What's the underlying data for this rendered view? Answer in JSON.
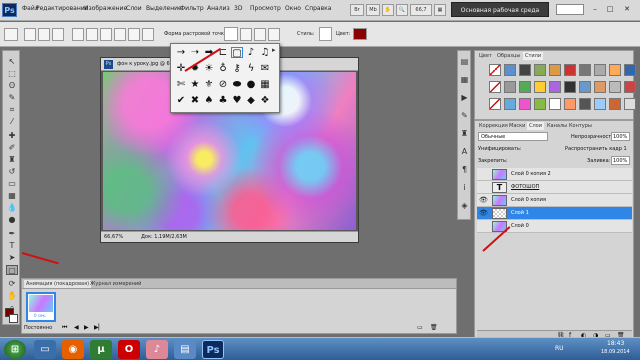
{
  "app": {
    "logo": "Ps"
  },
  "menu": [
    "Файл",
    "Редактирование",
    "Изображение",
    "Слои",
    "Выделение",
    "Фильтр",
    "Анализ",
    "3D",
    "Просмотр",
    "Окно",
    "Справка"
  ],
  "menubar": {
    "zoom": "66,7",
    "workspace_button": "Основная рабочая среда"
  },
  "options_bar": {
    "shape_label": "Форма растровой точки:",
    "style_label": "Стиль:",
    "color_label": "Цвет:",
    "color_value": "#8b0000"
  },
  "document": {
    "title": "фон к уроку.jpg @ 66,7",
    "zoom": "66,67%",
    "doc_info": "Док: 1,19M/2,63M"
  },
  "styles_panel": {
    "tabs": [
      "Цвет",
      "Образцы",
      "Стили"
    ]
  },
  "layers_panel": {
    "tabs": [
      "Коррекция",
      "Маски",
      "Слои",
      "Каналы",
      "Контуры"
    ],
    "blend_mode": "Обычные",
    "opacity_label": "Непрозрачность:",
    "opacity_value": "100%",
    "unify_label": "Унифицировать:",
    "propagate_label": "Распространить кадр 1",
    "lock_label": "Закрепить:",
    "fill_label": "Заливка:",
    "fill_value": "100%",
    "layers": [
      {
        "name": "Слой 0 копия 2"
      },
      {
        "name": "ФОТОШОП",
        "type_glyph": "T"
      },
      {
        "name": "Слой 0 копия"
      },
      {
        "name": "Слой 1"
      },
      {
        "name": "Слой 0"
      }
    ]
  },
  "animation_panel": {
    "tabs": [
      "Анимация (покадровая)",
      "Журнал измерений"
    ],
    "frame_delay": "0 сек.",
    "loop": "Постоянно"
  },
  "taskbar": {
    "time": "18:43",
    "date": "18.09.2014",
    "lang": "RU"
  },
  "colors": {
    "accent": "#2f86e6",
    "annotation": "#d01010"
  }
}
